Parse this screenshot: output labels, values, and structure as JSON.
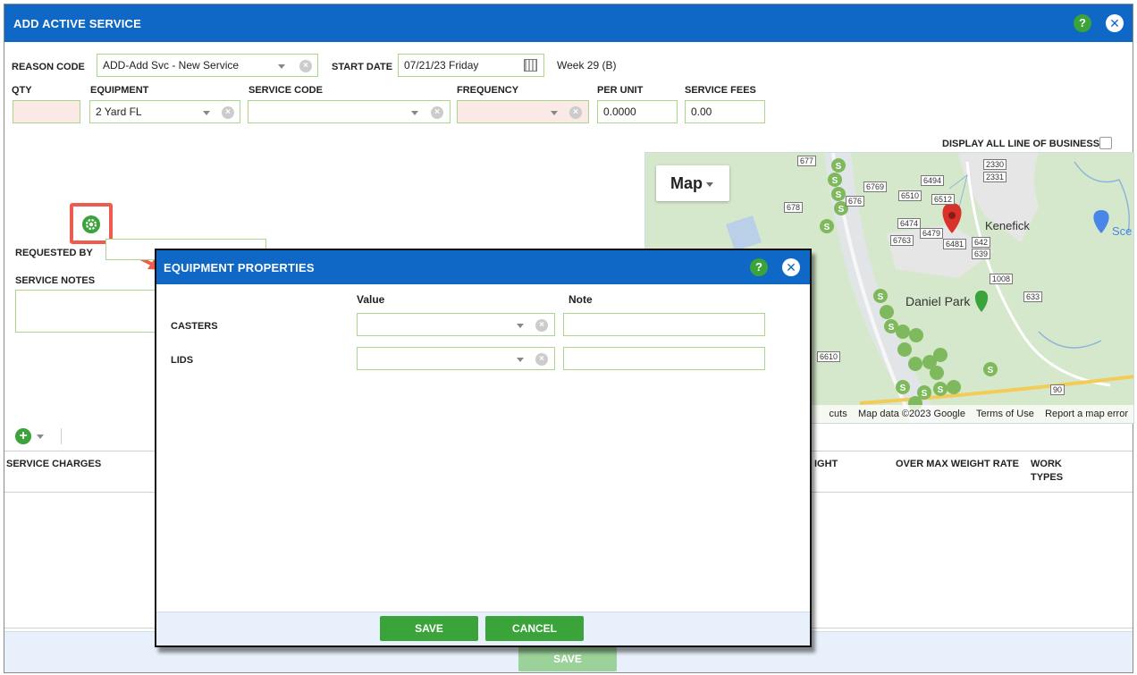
{
  "window": {
    "title": "ADD ACTIVE SERVICE",
    "help_label": "?",
    "close_label": "✕"
  },
  "form": {
    "reason_code_label": "REASON CODE",
    "reason_code_value": "ADD-Add Svc - New Service",
    "start_date_label": "START DATE",
    "start_date_value": "07/21/23 Friday",
    "week_text": "Week 29 (B)",
    "qty_label": "QTY",
    "qty_value": "",
    "equipment_label": "EQUIPMENT",
    "equipment_value": "2 Yard FL",
    "service_code_label": "SERVICE CODE",
    "service_code_value": "",
    "frequency_label": "FREQUENCY",
    "frequency_value": "",
    "per_unit_label": "PER UNIT",
    "per_unit_value": "0.0000",
    "service_fees_label": "SERVICE FEES",
    "service_fees_value": "0.00",
    "display_all_lob_label": "DISPLAY ALL LINE OF BUSINESS",
    "display_all_lob_checked": false,
    "requested_by_label": "REQUESTED BY",
    "service_notes_label": "SERVICE NOTES"
  },
  "map": {
    "type_button": "Map",
    "places": [
      "Kenefick",
      "Daniel Park",
      "Sce"
    ],
    "road_numbers": [
      "677",
      "2330",
      "2331",
      "6494",
      "6769",
      "6510",
      "6512",
      "676",
      "678",
      "6474",
      "6479",
      "6763",
      "6481",
      "642",
      "639",
      "1008",
      "633",
      "6610",
      "90"
    ],
    "footer_shortcuts": "cuts",
    "footer_data": "Map data ©2023 Google",
    "footer_terms": "Terms of Use",
    "footer_report": "Report a map error"
  },
  "lower": {
    "service_charges_label": "SERVICE CHARGES",
    "weight_col_partial": "IGHT",
    "over_max_weight_rate_label": "OVER MAX WEIGHT RATE",
    "work_types_label_1": "WORK",
    "work_types_label_2": "TYPES",
    "main_save_label": "SAVE"
  },
  "dialog": {
    "title": "EQUIPMENT PROPERTIES",
    "help_label": "?",
    "close_label": "✕",
    "col_value": "Value",
    "col_note": "Note",
    "rows": [
      {
        "label": "CASTERS",
        "value": "",
        "note": ""
      },
      {
        "label": "LIDS",
        "value": "",
        "note": ""
      }
    ],
    "save_label": "SAVE",
    "cancel_label": "CANCEL"
  },
  "colors": {
    "titlebar": "#0f67c6",
    "accent_green": "#3aa339",
    "field_border": "#a9d68c",
    "highlight_red": "#ee5c4e"
  }
}
